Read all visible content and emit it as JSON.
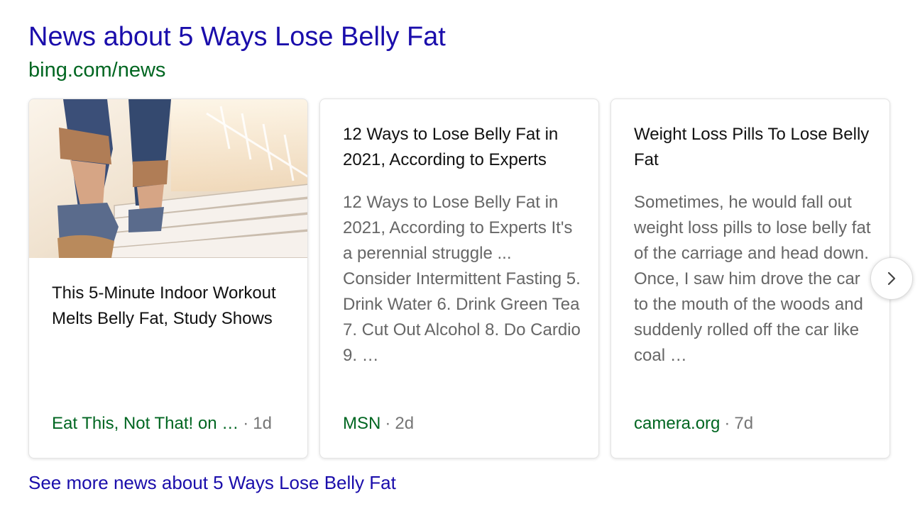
{
  "header": {
    "title": "News about 5 Ways Lose Belly Fat",
    "source_url": "bing.com/news"
  },
  "cards": [
    {
      "has_image": true,
      "title": "This 5-Minute Indoor Workout Melts Belly Fat, Study Shows",
      "snippet": "",
      "provider": "Eat This, Not That! on …",
      "separator": "·",
      "age": "1d"
    },
    {
      "has_image": false,
      "title": "12 Ways to Lose Belly Fat in 2021, According to Experts",
      "snippet": "12 Ways to Lose Belly Fat in 2021, According to Experts It's a perennial struggle ... Consider Intermittent Fasting 5. Drink Water 6. Drink Green Tea 7. Cut Out Alcohol 8. Do Cardio 9. …",
      "provider": "MSN",
      "separator": "·",
      "age": "2d"
    },
    {
      "has_image": false,
      "title": "Weight Loss Pills To Lose Belly Fat",
      "snippet": "Sometimes, he would fall out weight loss pills to lose belly fat of the carriage and head down. Once, I saw him drove the car to the mouth of the woods and suddenly rolled off the car like coal …",
      "provider": "camera.org",
      "separator": "·",
      "age": "7d"
    }
  ],
  "carousel": {
    "next_icon": "chevron-right-icon"
  },
  "footer": {
    "see_more": "See more news about 5 Ways Lose Belly Fat"
  },
  "colors": {
    "link": "#1a0dab",
    "url_green": "#006621",
    "snippet_gray": "#666666",
    "meta_gray": "#767676"
  }
}
